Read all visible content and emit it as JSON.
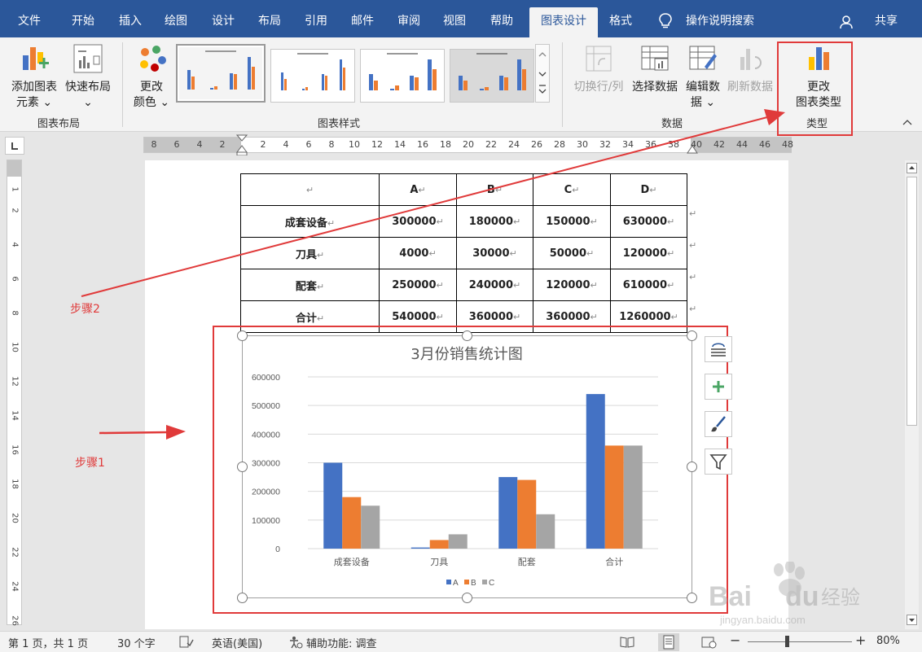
{
  "tabs": [
    "文件",
    "开始",
    "插入",
    "绘图",
    "设计",
    "布局",
    "引用",
    "邮件",
    "审阅",
    "视图",
    "帮助",
    "图表设计",
    "格式"
  ],
  "active_tab": "图表设计",
  "search": {
    "label": "操作说明搜索"
  },
  "share": {
    "label": "共享"
  },
  "ribbon": {
    "add_element": {
      "line1": "添加图表",
      "line2": "元素"
    },
    "quick_layout": {
      "line1": "快速布局"
    },
    "change_colors": {
      "line1": "更改",
      "line2": "颜色"
    },
    "switch_row_col": {
      "line1": "切换行/列"
    },
    "select_data": {
      "line1": "选择数据"
    },
    "edit_data": {
      "line1": "编辑数",
      "line2": "据"
    },
    "refresh_data": {
      "line1": "刷新数据"
    },
    "change_type": {
      "line1": "更改",
      "line2": "图表类型"
    },
    "groups": {
      "layout": "图表布局",
      "styles": "图表样式",
      "data": "数据",
      "type": "类型"
    }
  },
  "ruler": {
    "h": [
      "8",
      "6",
      "4",
      "2",
      "2",
      "4",
      "6",
      "8",
      "10",
      "12",
      "14",
      "16",
      "18",
      "20",
      "22",
      "24",
      "26",
      "28",
      "30",
      "32",
      "34",
      "36",
      "38",
      "40",
      "42",
      "44",
      "46",
      "48"
    ],
    "v": [
      "1",
      "2",
      "4",
      "6",
      "8",
      "10",
      "12",
      "14",
      "16",
      "18",
      "20",
      "22",
      "24",
      "26"
    ]
  },
  "table": {
    "header": [
      "",
      "A",
      "B",
      "C",
      "D"
    ],
    "rows": [
      [
        "成套设备",
        "300000",
        "180000",
        "150000",
        "630000"
      ],
      [
        "刀具",
        "4000",
        "30000",
        "50000",
        "120000"
      ],
      [
        "配套",
        "250000",
        "240000",
        "120000",
        "610000"
      ],
      [
        "合计",
        "540000",
        "360000",
        "360000",
        "1260000"
      ]
    ],
    "para_mark": "↵"
  },
  "annotations": {
    "step1": "步骤1",
    "step2": "步骤2"
  },
  "colors": {
    "accent": "#2b579a",
    "red": "#e03a3a",
    "seriesA": "#4472c4",
    "seriesB": "#ed7d31",
    "seriesC": "#a5a5a5"
  },
  "chart_data": {
    "type": "bar",
    "title": "3月份销售统计图",
    "categories": [
      "成套设备",
      "刀具",
      "配套",
      "合计"
    ],
    "series": [
      {
        "name": "A",
        "values": [
          300000,
          4000,
          250000,
          540000
        ]
      },
      {
        "name": "B",
        "values": [
          180000,
          30000,
          240000,
          360000
        ]
      },
      {
        "name": "C",
        "values": [
          150000,
          50000,
          120000,
          360000
        ]
      }
    ],
    "ylim": [
      0,
      600000
    ],
    "yticks": [
      "0",
      "100000",
      "200000",
      "300000",
      "400000",
      "500000",
      "600000"
    ],
    "grid": true,
    "legend": "bottom"
  },
  "status": {
    "page": "第 1 页，共 1 页",
    "words": "30 个字",
    "language": "英语(美国)",
    "accessibility": "辅助功能: 调查",
    "zoom": "80%"
  },
  "watermark": {
    "brand": "Bai",
    "brand2": "du",
    "brand3": "经验",
    "url": "jingyan.baidu.com"
  }
}
